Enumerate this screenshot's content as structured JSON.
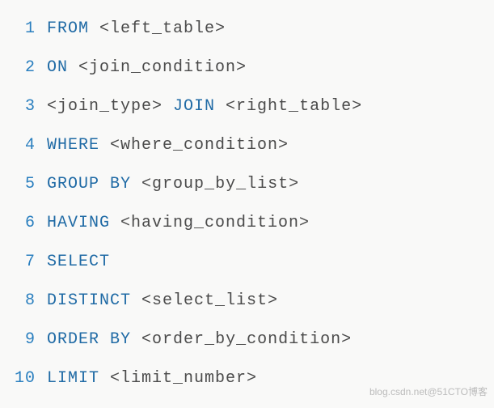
{
  "lines": [
    {
      "n": "1",
      "tokens": [
        {
          "cls": "kw",
          "t": "FROM"
        },
        {
          "cls": "pl",
          "t": " <left_table>"
        }
      ]
    },
    {
      "n": "2",
      "tokens": [
        {
          "cls": "kw",
          "t": "ON"
        },
        {
          "cls": "pl",
          "t": " <join_condition>"
        }
      ]
    },
    {
      "n": "3",
      "tokens": [
        {
          "cls": "pl",
          "t": "<join_type> "
        },
        {
          "cls": "kw",
          "t": "JOIN"
        },
        {
          "cls": "pl",
          "t": " <right_table>"
        }
      ]
    },
    {
      "n": "4",
      "tokens": [
        {
          "cls": "kw",
          "t": "WHERE"
        },
        {
          "cls": "pl",
          "t": " <where_condition>"
        }
      ]
    },
    {
      "n": "5",
      "tokens": [
        {
          "cls": "kw",
          "t": "GROUP"
        },
        {
          "cls": "pl",
          "t": " "
        },
        {
          "cls": "kw",
          "t": "BY"
        },
        {
          "cls": "pl",
          "t": " <group_by_list>"
        }
      ]
    },
    {
      "n": "6",
      "tokens": [
        {
          "cls": "kw",
          "t": "HAVING"
        },
        {
          "cls": "pl",
          "t": " <having_condition>"
        }
      ]
    },
    {
      "n": "7",
      "tokens": [
        {
          "cls": "kw",
          "t": "SELECT"
        }
      ]
    },
    {
      "n": "8",
      "tokens": [
        {
          "cls": "kw",
          "t": "DISTINCT"
        },
        {
          "cls": "pl",
          "t": " <select_list>"
        }
      ]
    },
    {
      "n": "9",
      "tokens": [
        {
          "cls": "kw",
          "t": "ORDER"
        },
        {
          "cls": "pl",
          "t": " "
        },
        {
          "cls": "kw",
          "t": "BY"
        },
        {
          "cls": "pl",
          "t": " <order_by_condition>"
        }
      ]
    },
    {
      "n": "10",
      "tokens": [
        {
          "cls": "kw",
          "t": "LIMIT"
        },
        {
          "cls": "pl",
          "t": " <limit_number>"
        }
      ]
    }
  ],
  "watermark": "blog.csdn.net@51CTO博客"
}
